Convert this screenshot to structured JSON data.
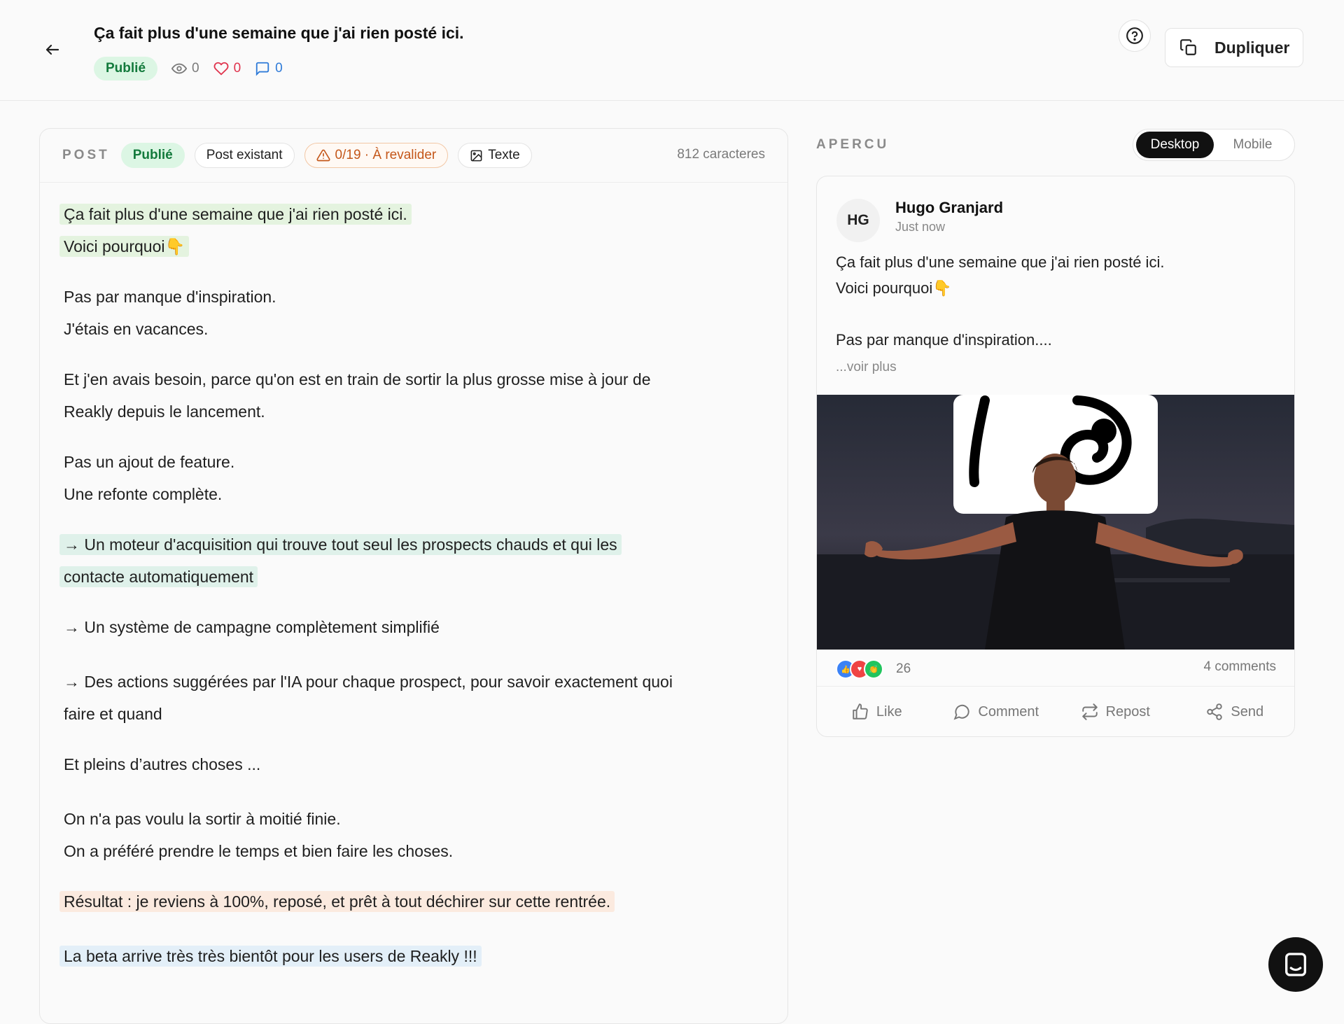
{
  "header": {
    "title": "Ça fait plus d'une semaine que j'ai rien posté ici.",
    "status": "Publié",
    "views": "0",
    "likes": "0",
    "comments": "0",
    "duplicate_label": "Dupliquer"
  },
  "editor": {
    "section_label": "POST",
    "status": "Publié",
    "existing_label": "Post existant",
    "validation_label": "0/19 · À revalider",
    "format_label": "Texte",
    "char_count": "812 caracteres",
    "paragraphs": [
      [
        "Ça fait plus d'une semaine que j'ai rien posté ici.",
        "Voici pourquoi👇"
      ],
      [
        "Pas par manque d'inspiration.",
        "J'étais en vacances."
      ],
      [
        "Et j'en avais besoin, parce qu'on est en train de sortir la plus grosse mise à jour de",
        "Reakly depuis le lancement."
      ],
      [
        "Pas un ajout de feature.",
        "Une refonte complète."
      ],
      [
        "→ Un moteur d'acquisition qui trouve tout seul les prospects chauds et qui les",
        "contacte automatiquement"
      ],
      [
        "→ Un système de campagne complètement simplifié"
      ],
      [
        "→ Des actions suggérées par l'IA pour chaque prospect, pour savoir exactement quoi",
        "faire et quand"
      ],
      [
        "Et pleins d’autres choses ..."
      ],
      [
        "On n'a pas voulu la sortir à moitié finie.",
        "On a préféré prendre le temps et bien faire les choses."
      ],
      [
        "Résultat : je reviens à 100%, reposé, et prêt à tout déchirer sur cette rentrée."
      ],
      [
        "La beta arrive très très bientôt pour les users de Reakly !!!"
      ]
    ]
  },
  "preview": {
    "section_label": "APERCU",
    "tabs": [
      "Desktop",
      "Mobile"
    ],
    "active_tab": "Desktop",
    "author_initials": "HG",
    "author_name": "Hugo Granjard",
    "timestamp": "Just now",
    "text_lines": [
      "Ça fait plus d'une semaine que j'ai rien posté ici.",
      "Voici pourquoi👇",
      "",
      "Pas par manque d'inspiration...."
    ],
    "see_more": "...voir plus",
    "reaction_count": "26",
    "comment_count": "4 comments",
    "actions": [
      "Like",
      "Comment",
      "Repost",
      "Send"
    ]
  },
  "colors": {
    "published_bg": "#dcf6e4",
    "published_text": "#137a3c",
    "warning": "#c4571a",
    "like_red": "#e0334d",
    "comment_blue": "#2f7bd8",
    "highlight_green": "#e4f3df",
    "highlight_teal": "#dff1ea",
    "highlight_peach": "#fbeadf",
    "highlight_blue": "#e3eff8"
  },
  "icons": [
    "arrow-left-icon",
    "eye-icon",
    "heart-icon",
    "comment-bubble-icon",
    "help-circle-icon",
    "copy-icon",
    "warning-triangle-icon",
    "image-text-icon",
    "like-icon",
    "comment-icon",
    "repost-icon",
    "send-icon",
    "chat-icon"
  ]
}
